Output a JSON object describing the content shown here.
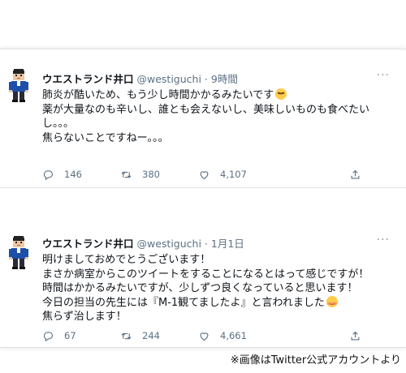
{
  "tweets": [
    {
      "name": "ウエストランド井口",
      "handle": "@westiguchi",
      "separator": "·",
      "time": "9時間",
      "lines": [
        "肺炎が酷いため、もう少し時間かかるみたいです",
        "薬が大量なのも辛いし、誰とも会えないし、美味しいものも食べたい",
        "し。。。",
        "焦らないことですねー。。。"
      ],
      "emoji": "pensive-face",
      "replies": "146",
      "retweets": "380",
      "likes": "4,107"
    },
    {
      "name": "ウエストランド井口",
      "handle": "@westiguchi",
      "separator": "·",
      "time": "1月1日",
      "lines": [
        "明けましておめでとうございます！",
        "まさか病室からこのツイートをすることになるとはって感じですが！",
        "時間はかかるみたいですが、少しずつ良くなっていると思います！",
        "今日の担当の先生には『M-1観てましたよ』と言われました",
        "焦らず治します！"
      ],
      "emoji": "smiling-face-with-blush",
      "replies": "67",
      "retweets": "244",
      "likes": "4,661"
    }
  ],
  "more_glyph": "···",
  "caption": "※画像はTwitter公式アカウントより"
}
